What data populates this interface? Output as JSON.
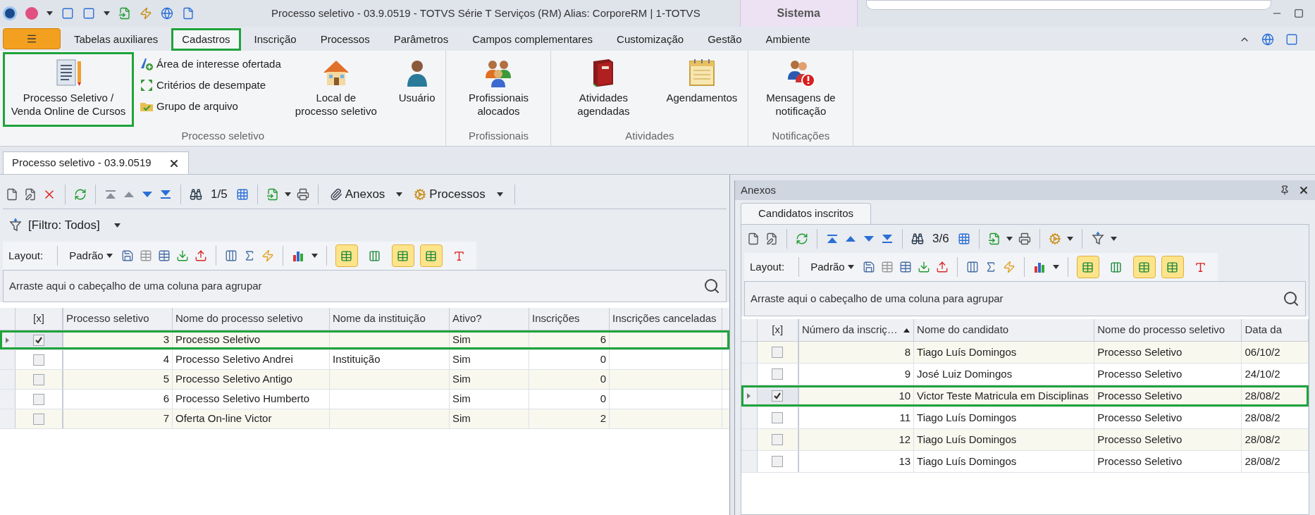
{
  "title_bar": {
    "title": "Processo seletivo - 03.9.0519 - TOTVS Série T Serviços (RM) Alias: CorporeRM | 1-TOTVS",
    "context_tab": "Sistema"
  },
  "ribbon_tabs": [
    {
      "label": "Tabelas auxiliares",
      "selected": false,
      "highlighted": false
    },
    {
      "label": "Cadastros",
      "selected": true,
      "highlighted": true
    },
    {
      "label": "Inscrição",
      "selected": false,
      "highlighted": false
    },
    {
      "label": "Processos",
      "selected": false,
      "highlighted": false
    },
    {
      "label": "Parâmetros",
      "selected": false,
      "highlighted": false
    },
    {
      "label": "Campos complementares",
      "selected": false,
      "highlighted": false
    },
    {
      "label": "Customização",
      "selected": false,
      "highlighted": false
    },
    {
      "label": "Gestão",
      "selected": false,
      "highlighted": false
    },
    {
      "label": "Ambiente",
      "selected": false,
      "highlighted": false
    }
  ],
  "ribbon_groups": [
    {
      "label": "Processo seletivo",
      "items": [
        {
          "kind": "large",
          "label": "Processo Seletivo / Venda Online de Cursos",
          "highlighted": true
        },
        {
          "kind": "stack",
          "entries": [
            {
              "label": "Área de interesse ofertada"
            },
            {
              "label": "Critérios de desempate"
            },
            {
              "label": "Grupo de arquivo"
            }
          ]
        },
        {
          "kind": "large",
          "label": "Local de processo seletivo",
          "highlighted": false
        },
        {
          "kind": "large",
          "label": "Usuário",
          "highlighted": false
        }
      ]
    },
    {
      "label": "Profissionais",
      "items": [
        {
          "kind": "large",
          "label": "Profissionais alocados",
          "highlighted": false
        }
      ]
    },
    {
      "label": "Atividades",
      "items": [
        {
          "kind": "large",
          "label": "Atividades agendadas",
          "highlighted": false
        },
        {
          "kind": "large",
          "label": "Agendamentos",
          "highlighted": false
        }
      ]
    },
    {
      "label": "Notificações",
      "items": [
        {
          "kind": "large",
          "label": "Mensagens de notificação",
          "highlighted": false
        }
      ]
    }
  ],
  "doc_tabs": [
    {
      "label": "Processo seletivo - 03.9.0519",
      "selected": true
    }
  ],
  "left_panel": {
    "toolbar": {
      "counter": "1/5",
      "attachments": "Anexos",
      "processes": "Processos"
    },
    "filter": "[Filtro: Todos]",
    "layout": {
      "label": "Layout:",
      "preset": "Padrão",
      "toggles": [
        {
          "on": true
        },
        {
          "on": false
        },
        {
          "on": true
        },
        {
          "on": true
        },
        {
          "on": false
        }
      ]
    },
    "group_hint": "Arraste aqui o cabeçalho de uma coluna para agrupar",
    "table": {
      "check_column": "[x]",
      "columns": [
        {
          "label": "Processo seletivo",
          "kind": "number"
        },
        {
          "label": "Nome do processo seletivo",
          "kind": "text"
        },
        {
          "label": "Nome da instituição",
          "kind": "text"
        },
        {
          "label": "Ativo?",
          "kind": "text"
        },
        {
          "label": "Inscrições",
          "kind": "number"
        },
        {
          "label": "Inscrições canceladas",
          "kind": "text"
        }
      ],
      "rows": [
        {
          "checked": true,
          "selected": true,
          "highlighted": true,
          "cells": [
            "3",
            "Processo Seletivo",
            "",
            "Sim",
            "6",
            ""
          ]
        },
        {
          "checked": false,
          "selected": false,
          "highlighted": false,
          "cells": [
            "4",
            "Processo Seletivo Andrei",
            "Instituição",
            "Sim",
            "0",
            ""
          ]
        },
        {
          "checked": false,
          "selected": false,
          "highlighted": false,
          "cells": [
            "5",
            "Processo Seletivo Antigo",
            "",
            "Sim",
            "0",
            ""
          ]
        },
        {
          "checked": false,
          "selected": false,
          "highlighted": false,
          "cells": [
            "6",
            "Processo Seletivo Humberto",
            "",
            "Sim",
            "0",
            ""
          ]
        },
        {
          "checked": false,
          "selected": false,
          "highlighted": false,
          "cells": [
            "7",
            "Oferta On-line Victor",
            "",
            "Sim",
            "2",
            ""
          ]
        }
      ]
    }
  },
  "right_panel": {
    "title": "Anexos",
    "tabs": [
      {
        "label": "Candidatos inscritos",
        "selected": true
      }
    ],
    "toolbar": {
      "counter": "3/6"
    },
    "layout": {
      "label": "Layout:",
      "preset": "Padrão",
      "toggles": [
        {
          "on": true
        },
        {
          "on": false
        },
        {
          "on": true
        },
        {
          "on": true
        },
        {
          "on": false
        }
      ]
    },
    "group_hint": "Arraste aqui o cabeçalho de uma coluna para agrupar",
    "table": {
      "check_column": "[x]",
      "columns": [
        {
          "label": "Número da inscriç…",
          "kind": "number",
          "sorted": true
        },
        {
          "label": "Nome do candidato",
          "kind": "text"
        },
        {
          "label": "Nome do processo seletivo",
          "kind": "text"
        },
        {
          "label": "Data da",
          "kind": "text"
        }
      ],
      "rows": [
        {
          "checked": false,
          "selected": false,
          "highlighted": false,
          "cells": [
            "8",
            "Tiago Luís Domingos",
            "Processo Seletivo",
            "06/10/2"
          ]
        },
        {
          "checked": false,
          "selected": false,
          "highlighted": false,
          "cells": [
            "9",
            "José Luiz Domingos",
            "Processo Seletivo",
            "24/10/2"
          ]
        },
        {
          "checked": true,
          "selected": true,
          "highlighted": true,
          "cells": [
            "10",
            "Victor Teste Matricula em Disciplinas",
            "Processo Seletivo",
            "28/08/2"
          ]
        },
        {
          "checked": false,
          "selected": false,
          "highlighted": false,
          "cells": [
            "11",
            "Tiago Luís Domingos",
            "Processo Seletivo",
            "28/08/2"
          ]
        },
        {
          "checked": false,
          "selected": false,
          "highlighted": false,
          "cells": [
            "12",
            "Tiago Luís Domingos",
            "Processo Seletivo",
            "28/08/2"
          ]
        },
        {
          "checked": false,
          "selected": false,
          "highlighted": false,
          "cells": [
            "13",
            "Tiago Luís Domingos",
            "Processo Seletivo",
            "28/08/2"
          ]
        }
      ]
    }
  }
}
